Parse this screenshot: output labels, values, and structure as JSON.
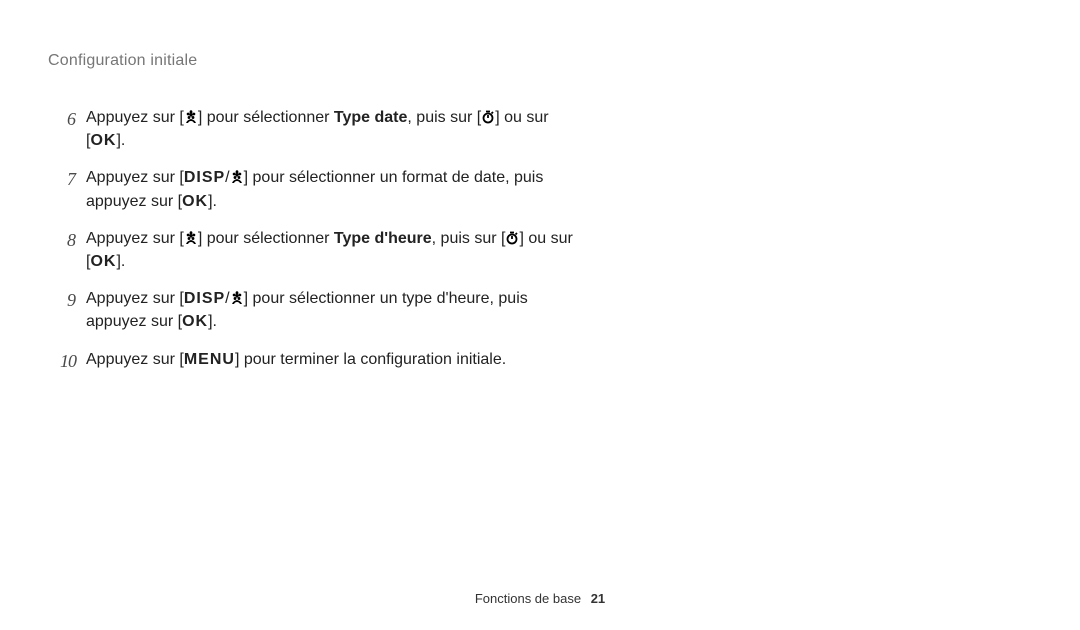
{
  "header": "Configuration initiale",
  "symbols": {
    "disp": "DISP",
    "ok": "OK",
    "menu": "MENU"
  },
  "steps": [
    {
      "num": "6",
      "t1": "Appuyez sur [",
      "t2": "] pour sélectionner ",
      "bold": "Type date",
      "t3": ", puis sur [",
      "t4": "] ou sur [",
      "t5": "]."
    },
    {
      "num": "7",
      "t1": "Appuyez sur [",
      "t2": "/",
      "t3": "] pour sélectionner un format de date, puis appuyez sur [",
      "t4": "]."
    },
    {
      "num": "8",
      "t1": "Appuyez sur [",
      "t2": "] pour sélectionner ",
      "bold": "Type d'heure",
      "t3": ", puis sur [",
      "t4": "] ou sur [",
      "t5": "]."
    },
    {
      "num": "9",
      "t1": "Appuyez sur [",
      "t2": "/",
      "t3": "] pour sélectionner un type d'heure, puis appuyez sur [",
      "t4": "]."
    },
    {
      "num": "10",
      "t1": "Appuyez sur [",
      "t2": "] pour terminer la configuration initiale."
    }
  ],
  "footer": {
    "section": "Fonctions de base",
    "page": "21"
  }
}
